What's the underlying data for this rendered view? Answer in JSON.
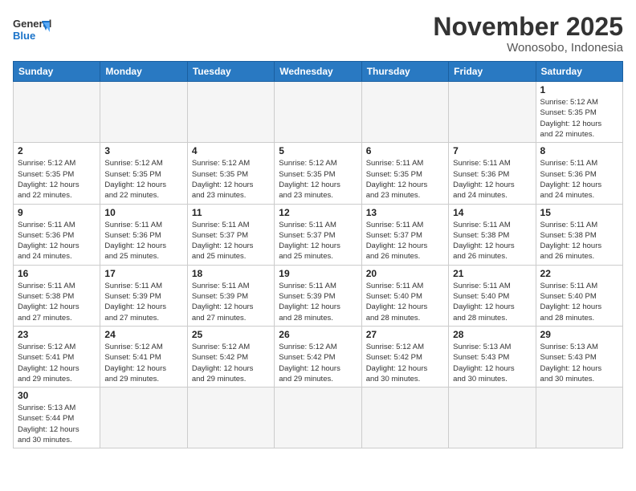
{
  "header": {
    "logo_general": "General",
    "logo_blue": "Blue",
    "month_title": "November 2025",
    "location": "Wonosobo, Indonesia"
  },
  "weekdays": [
    "Sunday",
    "Monday",
    "Tuesday",
    "Wednesday",
    "Thursday",
    "Friday",
    "Saturday"
  ],
  "weeks": [
    [
      {
        "day": null,
        "info": ""
      },
      {
        "day": null,
        "info": ""
      },
      {
        "day": null,
        "info": ""
      },
      {
        "day": null,
        "info": ""
      },
      {
        "day": null,
        "info": ""
      },
      {
        "day": null,
        "info": ""
      },
      {
        "day": "1",
        "info": "Sunrise: 5:12 AM\nSunset: 5:35 PM\nDaylight: 12 hours\nand 22 minutes."
      }
    ],
    [
      {
        "day": "2",
        "info": "Sunrise: 5:12 AM\nSunset: 5:35 PM\nDaylight: 12 hours\nand 22 minutes."
      },
      {
        "day": "3",
        "info": "Sunrise: 5:12 AM\nSunset: 5:35 PM\nDaylight: 12 hours\nand 22 minutes."
      },
      {
        "day": "4",
        "info": "Sunrise: 5:12 AM\nSunset: 5:35 PM\nDaylight: 12 hours\nand 23 minutes."
      },
      {
        "day": "5",
        "info": "Sunrise: 5:12 AM\nSunset: 5:35 PM\nDaylight: 12 hours\nand 23 minutes."
      },
      {
        "day": "6",
        "info": "Sunrise: 5:11 AM\nSunset: 5:35 PM\nDaylight: 12 hours\nand 23 minutes."
      },
      {
        "day": "7",
        "info": "Sunrise: 5:11 AM\nSunset: 5:36 PM\nDaylight: 12 hours\nand 24 minutes."
      },
      {
        "day": "8",
        "info": "Sunrise: 5:11 AM\nSunset: 5:36 PM\nDaylight: 12 hours\nand 24 minutes."
      }
    ],
    [
      {
        "day": "9",
        "info": "Sunrise: 5:11 AM\nSunset: 5:36 PM\nDaylight: 12 hours\nand 24 minutes."
      },
      {
        "day": "10",
        "info": "Sunrise: 5:11 AM\nSunset: 5:36 PM\nDaylight: 12 hours\nand 25 minutes."
      },
      {
        "day": "11",
        "info": "Sunrise: 5:11 AM\nSunset: 5:37 PM\nDaylight: 12 hours\nand 25 minutes."
      },
      {
        "day": "12",
        "info": "Sunrise: 5:11 AM\nSunset: 5:37 PM\nDaylight: 12 hours\nand 25 minutes."
      },
      {
        "day": "13",
        "info": "Sunrise: 5:11 AM\nSunset: 5:37 PM\nDaylight: 12 hours\nand 26 minutes."
      },
      {
        "day": "14",
        "info": "Sunrise: 5:11 AM\nSunset: 5:38 PM\nDaylight: 12 hours\nand 26 minutes."
      },
      {
        "day": "15",
        "info": "Sunrise: 5:11 AM\nSunset: 5:38 PM\nDaylight: 12 hours\nand 26 minutes."
      }
    ],
    [
      {
        "day": "16",
        "info": "Sunrise: 5:11 AM\nSunset: 5:38 PM\nDaylight: 12 hours\nand 27 minutes."
      },
      {
        "day": "17",
        "info": "Sunrise: 5:11 AM\nSunset: 5:39 PM\nDaylight: 12 hours\nand 27 minutes."
      },
      {
        "day": "18",
        "info": "Sunrise: 5:11 AM\nSunset: 5:39 PM\nDaylight: 12 hours\nand 27 minutes."
      },
      {
        "day": "19",
        "info": "Sunrise: 5:11 AM\nSunset: 5:39 PM\nDaylight: 12 hours\nand 28 minutes."
      },
      {
        "day": "20",
        "info": "Sunrise: 5:11 AM\nSunset: 5:40 PM\nDaylight: 12 hours\nand 28 minutes."
      },
      {
        "day": "21",
        "info": "Sunrise: 5:11 AM\nSunset: 5:40 PM\nDaylight: 12 hours\nand 28 minutes."
      },
      {
        "day": "22",
        "info": "Sunrise: 5:11 AM\nSunset: 5:40 PM\nDaylight: 12 hours\nand 28 minutes."
      }
    ],
    [
      {
        "day": "23",
        "info": "Sunrise: 5:12 AM\nSunset: 5:41 PM\nDaylight: 12 hours\nand 29 minutes."
      },
      {
        "day": "24",
        "info": "Sunrise: 5:12 AM\nSunset: 5:41 PM\nDaylight: 12 hours\nand 29 minutes."
      },
      {
        "day": "25",
        "info": "Sunrise: 5:12 AM\nSunset: 5:42 PM\nDaylight: 12 hours\nand 29 minutes."
      },
      {
        "day": "26",
        "info": "Sunrise: 5:12 AM\nSunset: 5:42 PM\nDaylight: 12 hours\nand 29 minutes."
      },
      {
        "day": "27",
        "info": "Sunrise: 5:12 AM\nSunset: 5:42 PM\nDaylight: 12 hours\nand 30 minutes."
      },
      {
        "day": "28",
        "info": "Sunrise: 5:13 AM\nSunset: 5:43 PM\nDaylight: 12 hours\nand 30 minutes."
      },
      {
        "day": "29",
        "info": "Sunrise: 5:13 AM\nSunset: 5:43 PM\nDaylight: 12 hours\nand 30 minutes."
      }
    ],
    [
      {
        "day": "30",
        "info": "Sunrise: 5:13 AM\nSunset: 5:44 PM\nDaylight: 12 hours\nand 30 minutes."
      },
      {
        "day": null,
        "info": ""
      },
      {
        "day": null,
        "info": ""
      },
      {
        "day": null,
        "info": ""
      },
      {
        "day": null,
        "info": ""
      },
      {
        "day": null,
        "info": ""
      },
      {
        "day": null,
        "info": ""
      }
    ]
  ]
}
